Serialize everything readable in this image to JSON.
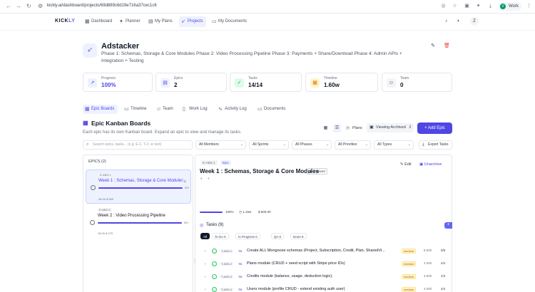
{
  "browser": {
    "url": "kickly.ai/dashboard/projects/69d889c6d19e716a37cec1c6",
    "profile_label": "Work",
    "profile_initial": "V"
  },
  "app": {
    "logo_main": "KICK",
    "logo_accent": "LY",
    "nav": [
      {
        "label": "Dashboard",
        "icon": "grid-icon"
      },
      {
        "label": "Planner",
        "icon": "sparkle-icon"
      },
      {
        "label": "My Plans",
        "icon": "folder-icon"
      },
      {
        "label": "Projects",
        "icon": "rocket-icon"
      },
      {
        "label": "My Documents",
        "icon": "document-icon"
      }
    ],
    "user_initial": "Z"
  },
  "project": {
    "title": "Adstacker",
    "description": "Phase 1: Schemas, Storage & Core Modules Phase 2: Video Processing Pipeline Phase 3: Payments + Share/Download Phase 4: Admin APIs + Integration + Testing"
  },
  "stats": [
    {
      "label": "Progress",
      "value": "100%",
      "icon": "trend-icon",
      "color": "#4f46e5"
    },
    {
      "label": "Epics",
      "value": "2",
      "icon": "layers-icon",
      "color": "#111827"
    },
    {
      "label": "Tasks",
      "value": "14/14",
      "icon": "check-circle-icon",
      "color": "#111827"
    },
    {
      "label": "Timeline",
      "value": "1.60w",
      "icon": "calendar-icon",
      "color": "#111827"
    },
    {
      "label": "Team",
      "value": "0",
      "icon": "users-icon",
      "color": "#111827"
    }
  ],
  "tabs": [
    {
      "label": "Epic Boards"
    },
    {
      "label": "Timeline"
    },
    {
      "label": "Team"
    },
    {
      "label": "Work Log"
    },
    {
      "label": "Activity Log"
    },
    {
      "label": "Documents"
    }
  ],
  "kanban": {
    "title": "Epic Kanban Boards",
    "subtitle": "Each epic has its own Kanban board. Expand an epic to view and manage its tasks.",
    "plans_label": "Plans",
    "viewing_archived_label": "Viewing Archived",
    "viewing_archived_count": "2",
    "add_epic_label": "+ Add Epic"
  },
  "filters": {
    "search_placeholder": "Search epics, tasks... (e.g. E-1, T-2, or text)",
    "members": "All Members",
    "sprints": "All Sprints",
    "phases": "All Phases",
    "priorities": "All Priorities",
    "types": "All Types",
    "export_label": "Export Tasks"
  },
  "epics_panel": {
    "heading": "EPICS (2)",
    "epics": [
      {
        "code": "E-ABS-1",
        "name": "Week 1 : Schemas, Storage & Core Modules",
        "badge": "9",
        "fraction": "9/9",
        "progress": 1.0,
        "meta_hours": "46.0h",
        "meta_cost": "$ 600"
      },
      {
        "code": "E-ABS-2",
        "name": "Week 2 : Video Processing Pipeline",
        "badge": "5",
        "fraction": "5/5",
        "progress": 1.0,
        "meta_hours": "18.0h",
        "meta_cost": "$ 270"
      }
    ]
  },
  "epic_detail": {
    "code": "E-ABS-1",
    "type_badge": "Epic",
    "title": "Week 1 : Schemas, Storage & Core Modules",
    "archived_badge": "Archived",
    "edit_label": "Edit",
    "unarchive_label": "Unarchive",
    "progress_pct": "100%",
    "duration": "1.15w",
    "cost": "$ 600.00",
    "tasks_heading": "Tasks (9)",
    "filter_tabs": [
      {
        "label": "All"
      },
      {
        "label": "To Do 0"
      },
      {
        "label": "In Progress 0"
      },
      {
        "label": "QA 0"
      },
      {
        "label": "Done 9"
      }
    ],
    "tasks": [
      {
        "code": "T-ABS-1",
        "type": "TS",
        "title": "Create ALL Mongoose schemas (Project, Subscription, Credit, Plan, SharedVi...",
        "priority": "medium",
        "hours": "8.00h",
        "count": "9/9"
      },
      {
        "code": "T-ABS-2",
        "type": "TS",
        "title": "Plans module (CRUD + seed script with Stripe price IDs)",
        "priority": "medium",
        "hours": "4.00h",
        "count": "4/4"
      },
      {
        "code": "T-ABS-3",
        "type": "TS",
        "title": "Credits module (balance, usage, deduction logic).",
        "priority": "medium",
        "hours": "4.00h",
        "count": "4/4"
      },
      {
        "code": "T-ABS-4",
        "type": "TS",
        "title": "Users module (profile CRUD - extend existing auth user)",
        "priority": "medium",
        "hours": "4.00h",
        "count": "4/4"
      }
    ]
  },
  "colors": {
    "accent": "#4f46e5",
    "accent_light": "#eef2ff",
    "success": "#22c55e",
    "danger": "#ef4444",
    "warning_bg": "#fef3c7"
  }
}
